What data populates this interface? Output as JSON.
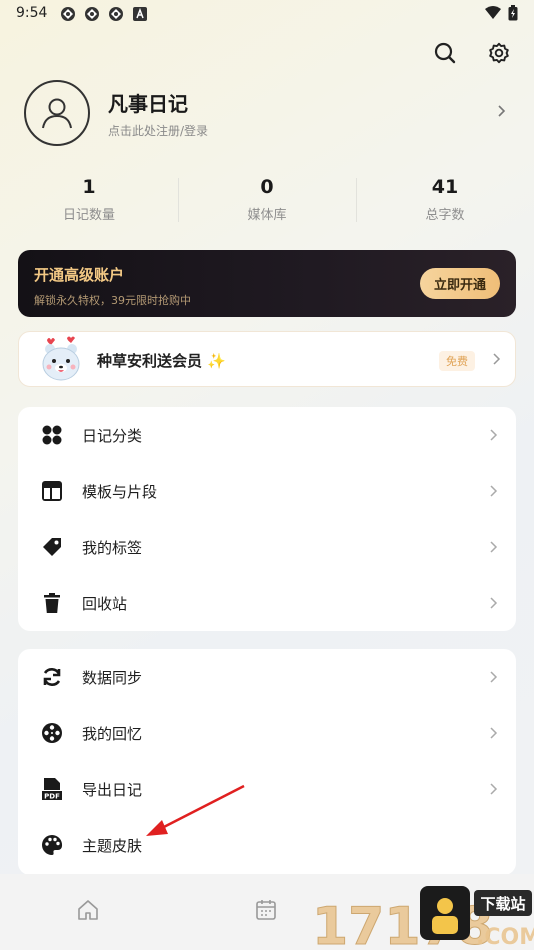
{
  "status": {
    "time": "9:54"
  },
  "profile": {
    "name": "凡事日记",
    "subtitle": "点击此处注册/登录"
  },
  "stats": [
    {
      "value": "1",
      "label": "日记数量"
    },
    {
      "value": "0",
      "label": "媒体库"
    },
    {
      "value": "41",
      "label": "总字数"
    }
  ],
  "vip": {
    "title": "开通高级账户",
    "subtitle": "解锁永久特权，39元限时抢购中",
    "button": "立即开通"
  },
  "promo": {
    "text": "种草安利送会员",
    "badge": "免费"
  },
  "menu_group1": [
    {
      "label": "日记分类",
      "icon": "grid-icon"
    },
    {
      "label": "模板与片段",
      "icon": "template-icon"
    },
    {
      "label": "我的标签",
      "icon": "tag-icon"
    },
    {
      "label": "回收站",
      "icon": "trash-icon"
    }
  ],
  "menu_group2": [
    {
      "label": "数据同步",
      "icon": "sync-icon"
    },
    {
      "label": "我的回忆",
      "icon": "film-reel-icon"
    },
    {
      "label": "导出日记",
      "icon": "pdf-icon"
    },
    {
      "label": "主题皮肤",
      "icon": "palette-icon"
    }
  ],
  "watermark": {
    "text": "17178",
    "badge": "下载站",
    "domain": ".COM"
  },
  "colors": {
    "vip_gold": "#f3c985",
    "vip_bg": "#141116",
    "annotation_arrow": "#e02020"
  }
}
